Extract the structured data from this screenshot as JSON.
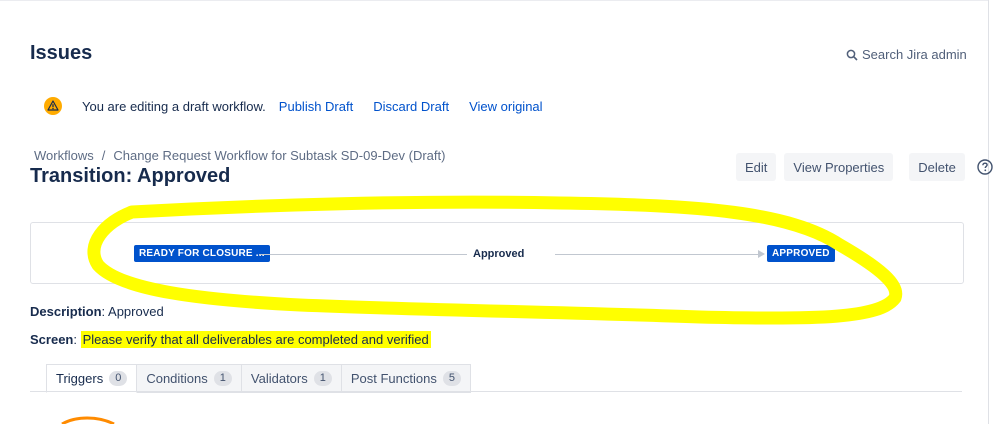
{
  "page": {
    "title": "Issues",
    "search_label": "Search Jira admin",
    "search_icon": "search-icon"
  },
  "banner": {
    "icon": "warning-icon",
    "message": "You are editing a draft workflow.",
    "links": [
      "Publish Draft",
      "Discard Draft",
      "View original"
    ]
  },
  "breadcrumb": {
    "root": "Workflows",
    "separator": "/",
    "current": "Change Request Workflow for Subtask SD-09-Dev (Draft)"
  },
  "transition": {
    "title": "Transition: Approved"
  },
  "actions": {
    "edit": "Edit",
    "view_properties": "View Properties",
    "delete": "Delete",
    "help_icon": "help-icon"
  },
  "diagram": {
    "from_status": "READY FOR CLOSURE ...",
    "transition_name": "Approved",
    "to_status": "APPROVED"
  },
  "description": {
    "label": "Description",
    "value": "Approved"
  },
  "screen": {
    "label": "Screen",
    "value": "Please verify that all deliverables are completed and verified"
  },
  "tabs": [
    {
      "label": "Triggers",
      "count": "0"
    },
    {
      "label": "Conditions",
      "count": "1"
    },
    {
      "label": "Validators",
      "count": "1"
    },
    {
      "label": "Post Functions",
      "count": "5"
    }
  ],
  "colors": {
    "link": "#0052cc",
    "lozenge": "#0052cc",
    "highlight": "#ffff00",
    "text": "#172b4d"
  }
}
